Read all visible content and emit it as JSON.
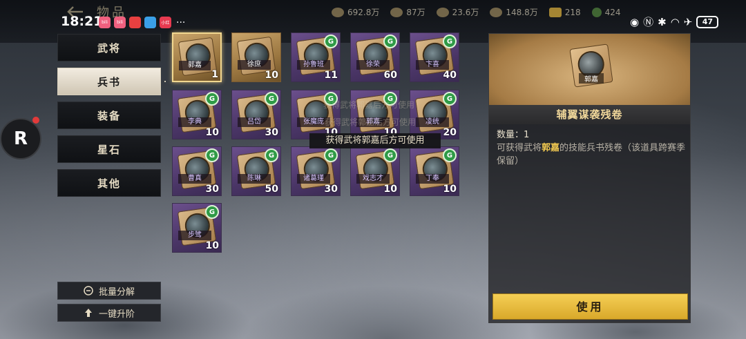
{
  "status_bar": {
    "time": "18:21",
    "battery": "47",
    "app_icons": [
      {
        "name": "bilibili-icon",
        "color": "#f0607f",
        "text": "bili"
      },
      {
        "name": "bilibili-icon",
        "color": "#f0607f",
        "text": "bili"
      },
      {
        "name": "red-app-icon",
        "color": "#e84040",
        "text": ""
      },
      {
        "name": "blue-app-icon",
        "color": "#3aa0e8",
        "text": ""
      },
      {
        "name": "ticket-app-icon",
        "color": "#e83a50",
        "text": "小红"
      }
    ]
  },
  "header": {
    "title": "物品",
    "resources": [
      {
        "name": "wood-icon",
        "value": "692.8万"
      },
      {
        "name": "iron-icon",
        "value": "87万"
      },
      {
        "name": "stone-icon",
        "value": "23.6万"
      },
      {
        "name": "grain-icon",
        "value": "148.8万"
      },
      {
        "name": "gold-icon",
        "value": "218"
      },
      {
        "name": "jade-icon",
        "value": "424"
      }
    ]
  },
  "menu": {
    "items": [
      "武将",
      "兵书",
      "装备",
      "星石",
      "其他"
    ],
    "active_index": 1
  },
  "bottom_buttons": {
    "batch_decompose": "批量分解",
    "one_click_upgrade": "一键升阶"
  },
  "items": [
    {
      "name": "郭嘉",
      "count": "1",
      "gold": true,
      "badge": false,
      "selected": true
    },
    {
      "name": "徐庶",
      "count": "10",
      "gold": true,
      "badge": false,
      "selected": false
    },
    {
      "name": "孙鲁班",
      "count": "11",
      "gold": false,
      "badge": true,
      "selected": false
    },
    {
      "name": "徐荣",
      "count": "60",
      "gold": false,
      "badge": true,
      "selected": false
    },
    {
      "name": "卞喜",
      "count": "40",
      "gold": false,
      "badge": true,
      "selected": false
    },
    {
      "name": "李典",
      "count": "10",
      "gold": false,
      "badge": true,
      "selected": false
    },
    {
      "name": "吕岱",
      "count": "30",
      "gold": false,
      "badge": true,
      "selected": false
    },
    {
      "name": "张魔庞",
      "count": "10",
      "gold": false,
      "badge": true,
      "selected": false
    },
    {
      "name": "郭嘉",
      "count": "10",
      "gold": false,
      "badge": true,
      "selected": false
    },
    {
      "name": "凌统",
      "count": "20",
      "gold": false,
      "badge": true,
      "selected": false
    },
    {
      "name": "曹真",
      "count": "30",
      "gold": false,
      "badge": true,
      "selected": false
    },
    {
      "name": "陈琳",
      "count": "50",
      "gold": false,
      "badge": true,
      "selected": false
    },
    {
      "name": "诸葛瑾",
      "count": "30",
      "gold": false,
      "badge": true,
      "selected": false
    },
    {
      "name": "戏志才",
      "count": "10",
      "gold": false,
      "badge": true,
      "selected": false
    },
    {
      "name": "丁奉",
      "count": "10",
      "gold": false,
      "badge": true,
      "selected": false
    },
    {
      "name": "步骘",
      "count": "10",
      "gold": false,
      "badge": true,
      "selected": false
    }
  ],
  "tooltip": {
    "text": "获得武将郭嘉后方可使用",
    "ghost_1": "获得武将郭嘉后方可使用",
    "ghost_2": "获得武将郭嘉后方可使用"
  },
  "detail": {
    "book_label": "郭嘉",
    "title": "辅翼谋袭残卷",
    "quantity": "数量：1",
    "desc_prefix": "可获得武将",
    "desc_hero": "郭嘉",
    "desc_suffix": "的技能兵书残卷（该道具跨赛季保留）",
    "use_button": "使用"
  },
  "colors": {
    "accent_gold": "#f5cf55",
    "badge_green": "#2f9a46",
    "card_purple": "#4a3566"
  }
}
